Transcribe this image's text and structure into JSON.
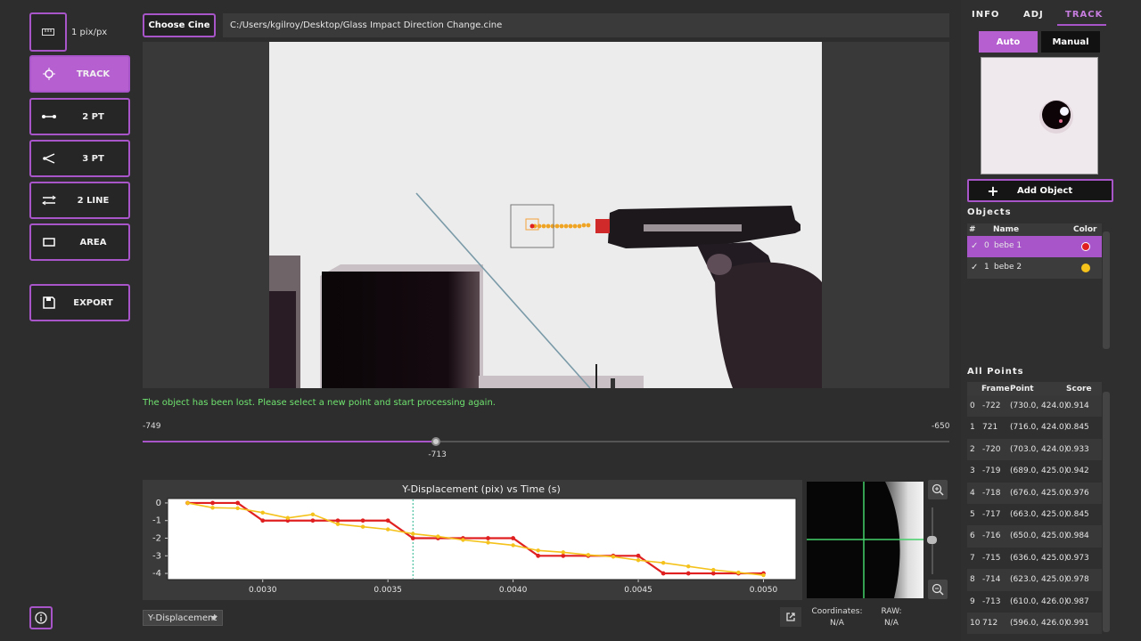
{
  "toolbar": {
    "scale_label": "1 pix/px",
    "tools": [
      {
        "label": "TRACK",
        "icon": "track-target-icon",
        "active": true
      },
      {
        "label": "2 PT",
        "icon": "two-point-icon",
        "active": false
      },
      {
        "label": "3 PT",
        "icon": "three-point-angle-icon",
        "active": false
      },
      {
        "label": "2 LINE",
        "icon": "two-line-icon",
        "active": false
      },
      {
        "label": "AREA",
        "icon": "area-rectangle-icon",
        "active": false
      }
    ],
    "export_label": "EXPORT"
  },
  "file": {
    "choose_label": "Choose Cine",
    "path": "C:/Users/kgilroy/Desktop/Glass Impact Direction Change.cine"
  },
  "status_message": "The object has been lost. Please select a new point and start processing again.",
  "frame_slider": {
    "min": "-749",
    "max": "-650",
    "current": "-713",
    "fraction": 0.364
  },
  "chart": {
    "dropdown_value": "Y-Displacement"
  },
  "chart_data": {
    "type": "line",
    "title": "Y-Displacement (pix) vs Time (s)",
    "xlabel": "",
    "ylabel": "",
    "x_ticks": [
      "0.0030",
      "0.0035",
      "0.0040",
      "0.0045",
      "0.0050"
    ],
    "y_ticks": [
      "0",
      "-1",
      "-2",
      "-3",
      "-4"
    ],
    "xlim": [
      0.00262,
      0.00513
    ],
    "ylim": [
      -4.35,
      0.25
    ],
    "cursor_x": 0.0036,
    "series": [
      {
        "color": "#e02020",
        "x": [
          0.0027,
          0.0028,
          0.0029,
          0.003,
          0.0031,
          0.0032,
          0.0033,
          0.0034,
          0.0035,
          0.0036,
          0.0037,
          0.0038,
          0.0039,
          0.004,
          0.0041,
          0.0042,
          0.0043,
          0.0044,
          0.0045,
          0.0046,
          0.0047,
          0.0048,
          0.0049,
          0.005
        ],
        "y": [
          0,
          0,
          0,
          -1,
          -1,
          -1,
          -1,
          -1,
          -1,
          -2,
          -2,
          -2,
          -2,
          -2,
          -3,
          -3,
          -3,
          -3,
          -3,
          -4,
          -4,
          -4,
          -4,
          -4
        ]
      },
      {
        "color": "#f4c21a",
        "x": [
          0.0027,
          0.0028,
          0.0029,
          0.003,
          0.0031,
          0.0032,
          0.0033,
          0.0034,
          0.0035,
          0.0036,
          0.0037,
          0.0038,
          0.0039,
          0.004,
          0.0041,
          0.0042,
          0.0043,
          0.0044,
          0.0045,
          0.0046,
          0.0047,
          0.0048,
          0.0049,
          0.005
        ],
        "y": [
          0,
          -0.27,
          -0.3,
          -0.55,
          -0.85,
          -0.65,
          -1.2,
          -1.35,
          -1.5,
          -1.75,
          -1.9,
          -2.1,
          -2.25,
          -2.4,
          -2.7,
          -2.8,
          -2.95,
          -3.05,
          -3.25,
          -3.4,
          -3.6,
          -3.8,
          -3.95,
          -4.1
        ]
      }
    ]
  },
  "readout": {
    "coords_label": "Coordinates:",
    "coords_value": "N/A",
    "raw_label": "RAW:",
    "raw_value": "N/A"
  },
  "tabs": [
    {
      "label": "INFO",
      "active": false
    },
    {
      "label": "ADJ",
      "active": false
    },
    {
      "label": "TRACK",
      "active": true
    }
  ],
  "mode": {
    "auto": "Auto",
    "manual": "Manual",
    "selected": "Auto"
  },
  "add_object_label": "Add Object",
  "objects_header": "Objects",
  "objects_columns": [
    "#",
    "Name",
    "Color"
  ],
  "objects": [
    {
      "index": "0",
      "name": "bebe 1",
      "color": "#e02020",
      "checked": true,
      "selected": true
    },
    {
      "index": "1",
      "name": "bebe 2",
      "color": "#f4c21a",
      "checked": true,
      "selected": false
    }
  ],
  "points_header": "All Points",
  "points_columns": [
    "Frame",
    "Point",
    "Score"
  ],
  "points": [
    {
      "i": "0",
      "frame": "-722",
      "point": "(730.0, 424.0)",
      "score": "0.914"
    },
    {
      "i": "1",
      "frame": "721",
      "point": "(716.0, 424.0)",
      "score": "0.845"
    },
    {
      "i": "2",
      "frame": "-720",
      "point": "(703.0, 424.0)",
      "score": "0.933"
    },
    {
      "i": "3",
      "frame": "-719",
      "point": "(689.0, 425.0)",
      "score": "0.942"
    },
    {
      "i": "4",
      "frame": "-718",
      "point": "(676.0, 425.0)",
      "score": "0.976"
    },
    {
      "i": "5",
      "frame": "-717",
      "point": "(663.0, 425.0)",
      "score": "0.845"
    },
    {
      "i": "6",
      "frame": "-716",
      "point": "(650.0, 425.0)",
      "score": "0.984"
    },
    {
      "i": "7",
      "frame": "-715",
      "point": "(636.0, 425.0)",
      "score": "0.973"
    },
    {
      "i": "8",
      "frame": "-714",
      "point": "(623.0, 425.0)",
      "score": "0.978"
    },
    {
      "i": "9",
      "frame": "-713",
      "point": "(610.0, 426.0)",
      "score": "0.987"
    },
    {
      "i": "10",
      "frame": "712",
      "point": "(596.0, 426.0)",
      "score": "0.991"
    }
  ]
}
